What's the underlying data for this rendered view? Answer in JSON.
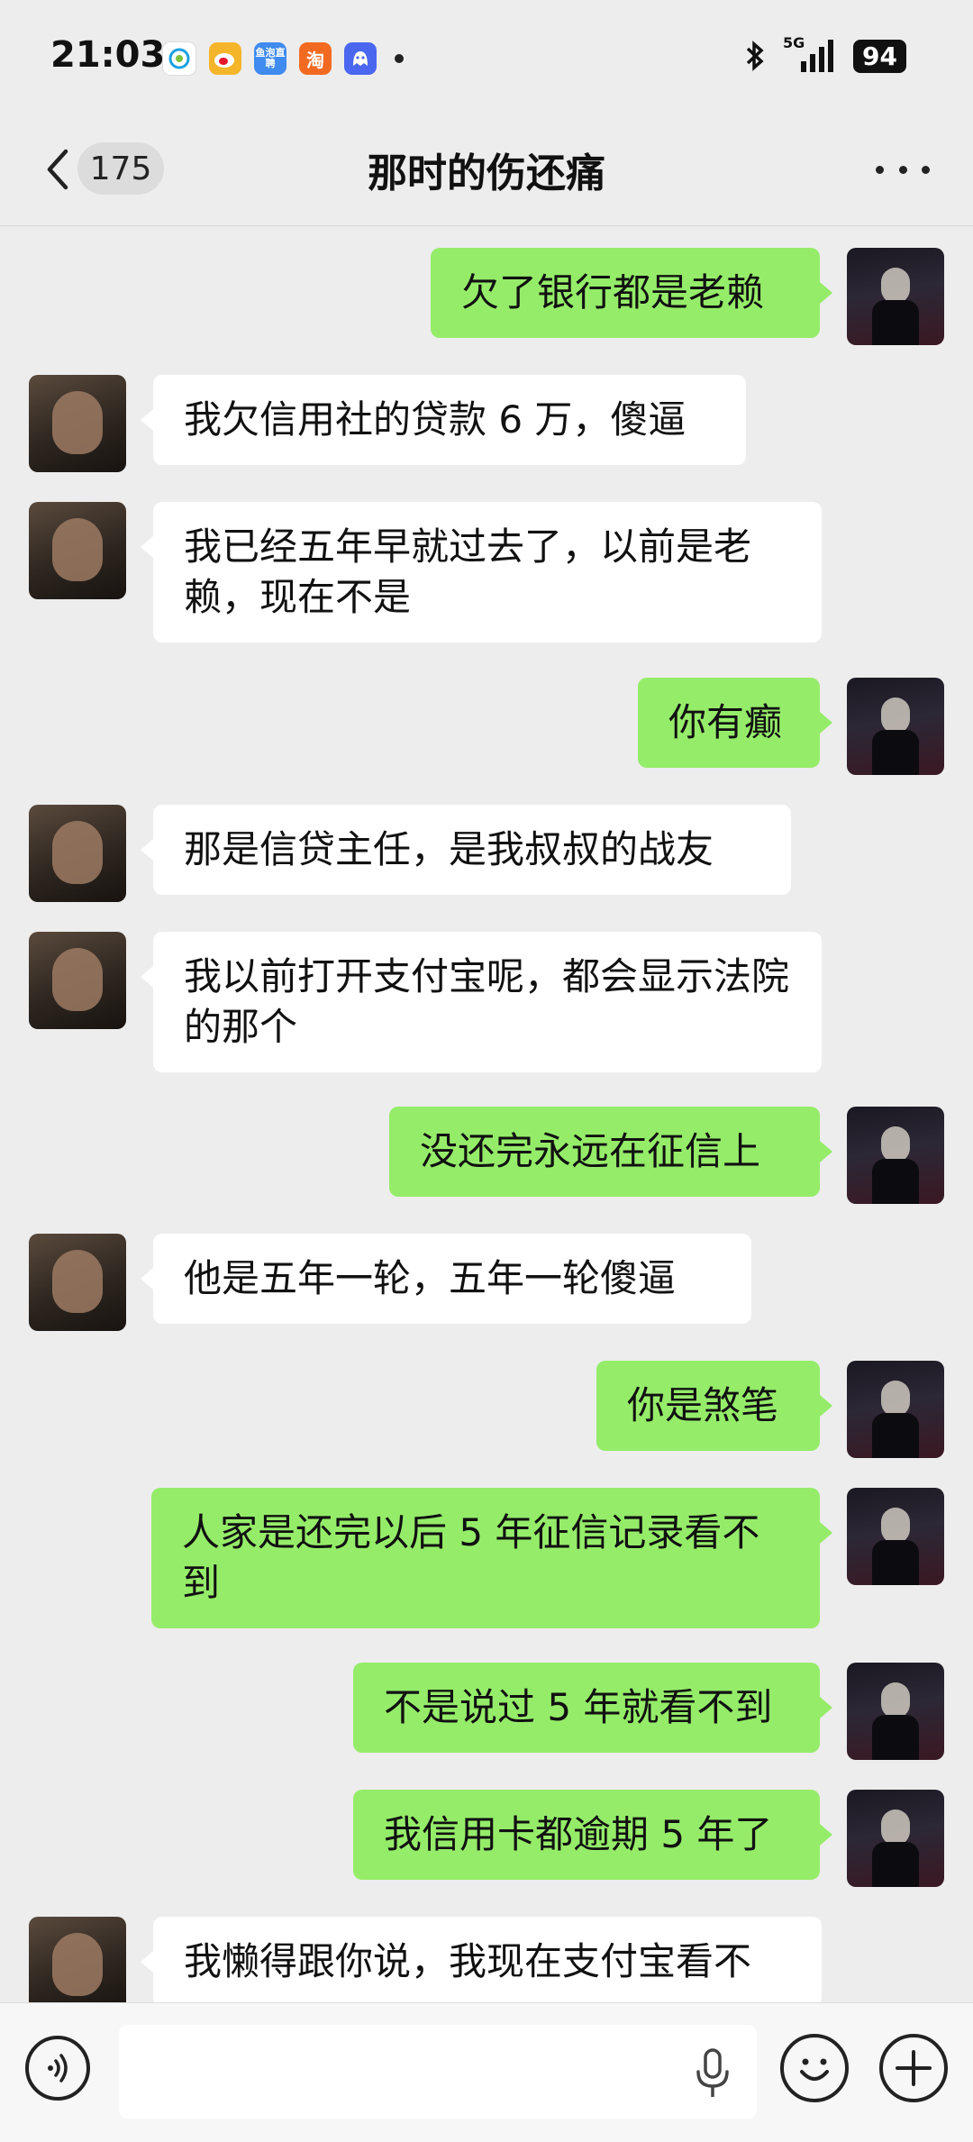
{
  "status_bar": {
    "time": "21:03",
    "network": "5G",
    "battery": "94",
    "apps": [
      {
        "icon": "china-mobile-icon",
        "label": "",
        "color": "#ffffff"
      },
      {
        "icon": "weibo-icon",
        "label": "",
        "color": "#f5b52a"
      },
      {
        "icon": "douyu-icon",
        "label": "鱼泡直聘",
        "color": "#3f8bef"
      },
      {
        "icon": "taobao-icon",
        "label": "淘",
        "color": "#f26a21"
      },
      {
        "icon": "qq-icon",
        "label": "",
        "color": "#4b67f0"
      }
    ]
  },
  "header": {
    "unread_count": "175",
    "title": "那时的伤还痛"
  },
  "messages": [
    {
      "side": "out",
      "text": "欠了银行都是老赖"
    },
    {
      "side": "in",
      "text": "我欠信用社的贷款 6 万，傻逼"
    },
    {
      "side": "in",
      "text": "我已经五年早就过去了，以前是老赖，现在不是"
    },
    {
      "side": "out",
      "text": "你有癫"
    },
    {
      "side": "in",
      "text": "那是信贷主任，是我叔叔的战友"
    },
    {
      "side": "in",
      "text": "我以前打开支付宝呢，都会显示法院的那个"
    },
    {
      "side": "out",
      "text": "没还完永远在征信上"
    },
    {
      "side": "in",
      "text": "他是五年一轮，五年一轮傻逼"
    },
    {
      "side": "out",
      "text": "你是煞笔"
    },
    {
      "side": "out",
      "text": "人家是还完以后 5 年征信记录看不到"
    },
    {
      "side": "out",
      "text": "不是说过 5 年就看不到"
    },
    {
      "side": "out",
      "text": "我信用卡都逾期 5 年了"
    },
    {
      "side": "in",
      "text": "我懒得跟你说，我现在支付宝看不"
    }
  ],
  "input": {
    "value": "",
    "placeholder": ""
  },
  "colors": {
    "outgoing_bubble": "#95ec69",
    "incoming_bubble": "#ffffff",
    "background": "#ededed"
  }
}
